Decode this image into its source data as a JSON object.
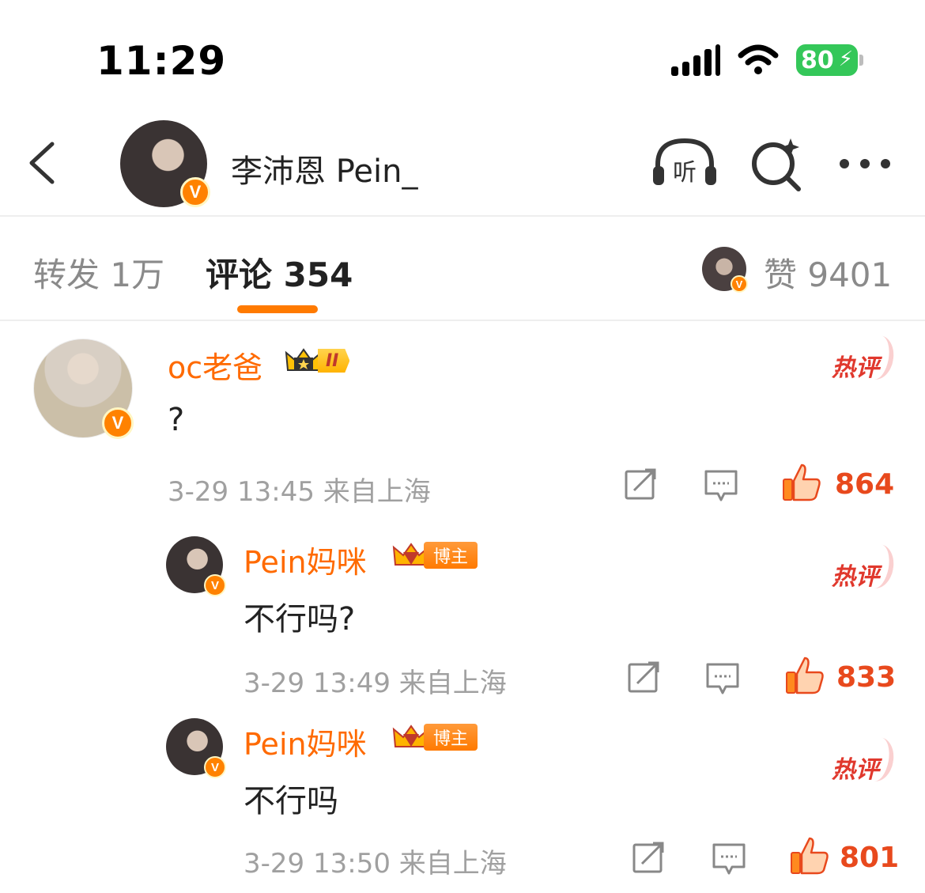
{
  "status_bar": {
    "time": "11:29",
    "battery": "80"
  },
  "header": {
    "title": "李沛恩 Pein_",
    "listen_label": "听"
  },
  "tabs": {
    "repost": "转发 1万",
    "comments": "评论 354",
    "likes": "赞 9401"
  },
  "colors": {
    "accent": "#ff7a00",
    "like": "#e8491d",
    "hot": "#e0382d"
  },
  "comments": [
    {
      "username": "oc老爸",
      "badge": "II",
      "text": "?",
      "time": "3-29 13:45",
      "location": "来自上海",
      "likes": "864",
      "hot_label": "热评"
    },
    {
      "username": "Pein妈咪",
      "badge": "博主",
      "text": "不行吗?",
      "time": "3-29 13:49",
      "location": "来自上海",
      "likes": "833",
      "hot_label": "热评"
    },
    {
      "username": "Pein妈咪",
      "badge": "博主",
      "text": "不行吗",
      "time": "3-29 13:50",
      "location": "来自上海",
      "likes": "801",
      "hot_label": "热评"
    }
  ]
}
